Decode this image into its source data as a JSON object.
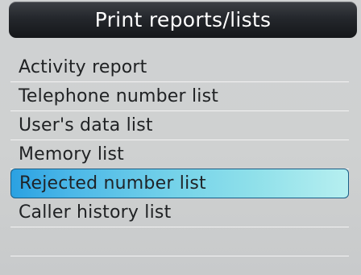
{
  "screen": {
    "title": "Print reports/lists",
    "menu": [
      {
        "label": "Activity report",
        "selected": false
      },
      {
        "label": "Telephone number list",
        "selected": false
      },
      {
        "label": "User's data list",
        "selected": false
      },
      {
        "label": "Memory list",
        "selected": false
      },
      {
        "label": "Rejected number list",
        "selected": true
      },
      {
        "label": "Caller history list",
        "selected": false
      },
      {
        "label": "",
        "selected": false
      },
      {
        "label": "",
        "selected": false
      }
    ]
  },
  "colors": {
    "title_bar": "#1b1d21",
    "background": "#cfd1d2",
    "selection": "#74d2e9",
    "text": "#202224"
  }
}
